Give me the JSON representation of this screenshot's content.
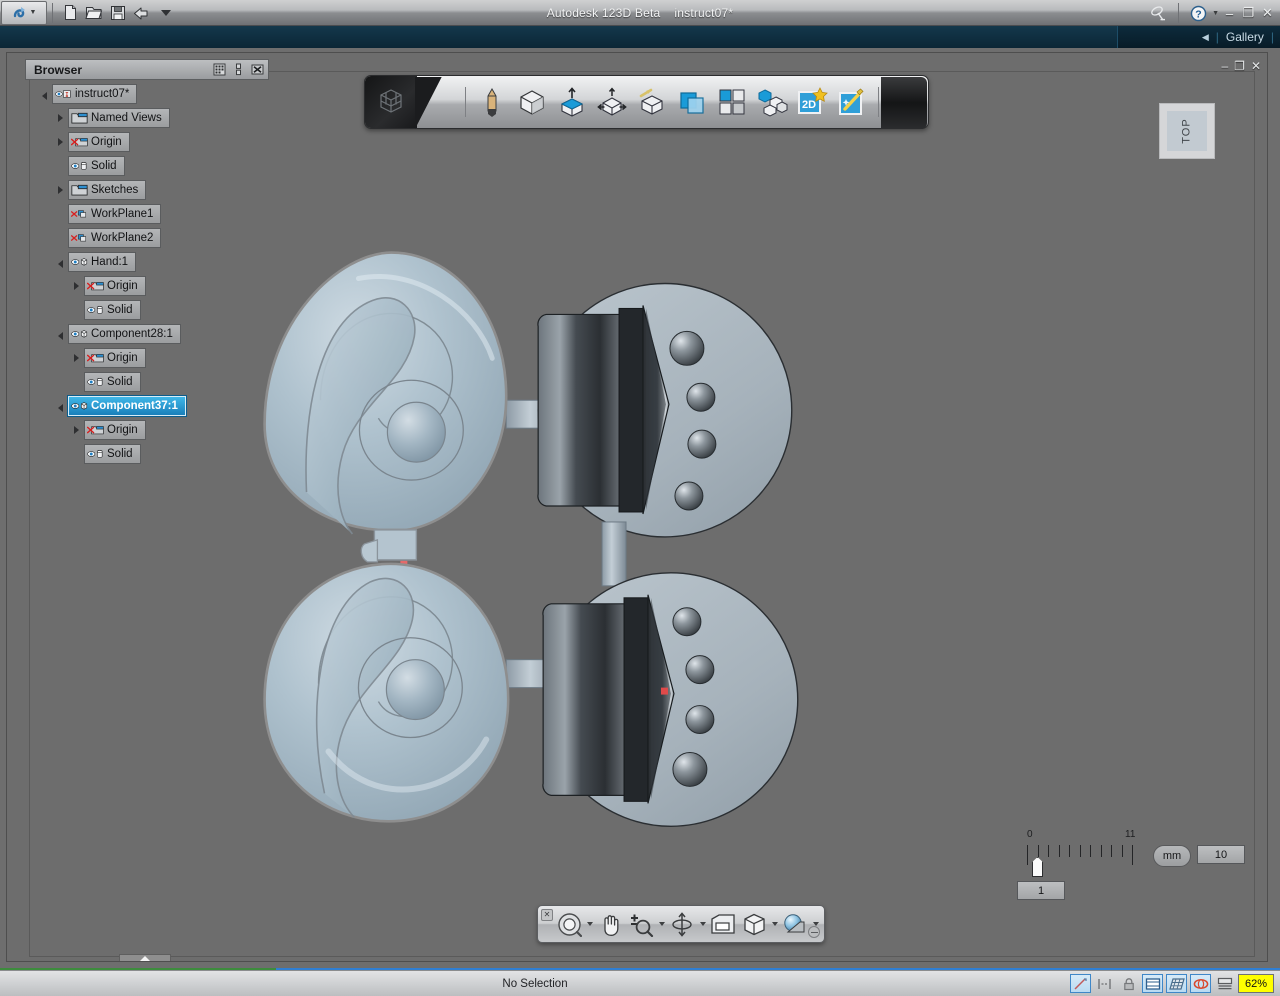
{
  "titlebar": {
    "app_title": "Autodesk 123D Beta",
    "document_title": "instruct07*",
    "icons": [
      {
        "name": "app-logo-icon",
        "label": "123D"
      },
      {
        "name": "new-file-icon",
        "label": "New"
      },
      {
        "name": "open-file-icon",
        "label": "Open"
      },
      {
        "name": "save-icon",
        "label": "Save"
      },
      {
        "name": "undo-icon",
        "label": "Undo"
      },
      {
        "name": "quick-access-dropdown-icon",
        "label": "Customize"
      }
    ],
    "right_icons": [
      {
        "name": "broadcast-icon",
        "label": "Communication Center"
      },
      {
        "name": "help-icon",
        "label": "Help"
      }
    ],
    "window_buttons": {
      "minimize": "–",
      "restore": "❐",
      "close": "✕"
    }
  },
  "docbar": {
    "collapse_arrow": "◀",
    "divider": "|",
    "gallery_label": "Gallery",
    "trailing_divider": "|"
  },
  "document_window_buttons": {
    "minimize": "–",
    "restore": "❐",
    "close": "✕"
  },
  "browser": {
    "title": "Browser",
    "header_buttons": [
      {
        "name": "browser-display-toggle-button",
        "label": "Display"
      },
      {
        "name": "browser-dock-button",
        "label": "Dock"
      },
      {
        "name": "browser-close-button",
        "label": "Close"
      }
    ],
    "tree": [
      {
        "label": "instruct07*",
        "indent": 0,
        "twist": "open",
        "icon": "eye-pin-icon",
        "selected": false
      },
      {
        "label": "Named Views",
        "indent": 1,
        "twist": "closed",
        "icon": "folder-icon",
        "selected": false
      },
      {
        "label": "Origin",
        "indent": 1,
        "twist": "closed",
        "icon": "hidden-folder-icon",
        "selected": false
      },
      {
        "label": "Solid",
        "indent": 1,
        "twist": "none",
        "icon": "eye-solid-icon",
        "selected": false
      },
      {
        "label": "Sketches",
        "indent": 1,
        "twist": "closed",
        "icon": "folder-icon",
        "selected": false
      },
      {
        "label": "WorkPlane1",
        "indent": 1,
        "twist": "none",
        "icon": "hidden-plane-icon",
        "selected": false
      },
      {
        "label": "WorkPlane2",
        "indent": 1,
        "twist": "none",
        "icon": "hidden-plane-icon",
        "selected": false
      },
      {
        "label": "Hand:1",
        "indent": 1,
        "twist": "open",
        "icon": "eye-cube-icon",
        "selected": false
      },
      {
        "label": "Origin",
        "indent": 2,
        "twist": "closed",
        "icon": "hidden-folder-icon",
        "selected": false
      },
      {
        "label": "Solid",
        "indent": 2,
        "twist": "none",
        "icon": "eye-solid-icon",
        "selected": false
      },
      {
        "label": "Component28:1",
        "indent": 1,
        "twist": "open",
        "icon": "eye-cube-icon",
        "selected": false
      },
      {
        "label": "Origin",
        "indent": 2,
        "twist": "closed",
        "icon": "hidden-folder-icon",
        "selected": false
      },
      {
        "label": "Solid",
        "indent": 2,
        "twist": "none",
        "icon": "eye-solid-icon",
        "selected": false
      },
      {
        "label": "Component37:1",
        "indent": 1,
        "twist": "open",
        "icon": "eye-cube-icon",
        "selected": true
      },
      {
        "label": "Origin",
        "indent": 2,
        "twist": "closed",
        "icon": "hidden-folder-icon",
        "selected": false
      },
      {
        "label": "Solid",
        "indent": 2,
        "twist": "none",
        "icon": "eye-solid-icon",
        "selected": false
      }
    ]
  },
  "main_toolbar": {
    "buttons": [
      {
        "name": "sketch-pencil-icon",
        "label": "Sketch"
      },
      {
        "name": "primitives-cube-icon",
        "label": "Primitives"
      },
      {
        "name": "construct-extrude-icon",
        "label": "Construct"
      },
      {
        "name": "modify-move-icon",
        "label": "Modify"
      },
      {
        "name": "pattern-arrow-cube-icon",
        "label": "Pattern"
      },
      {
        "name": "combine-layers-icon",
        "label": "Combine"
      },
      {
        "name": "grid-snap-icon",
        "label": "Grid"
      },
      {
        "name": "assemble-blocks-icon",
        "label": "Assemble"
      },
      {
        "name": "drawing-2d-icon",
        "label": "2D Drawing"
      },
      {
        "name": "smart-wand-icon",
        "label": "Smart Tools"
      }
    ]
  },
  "viewcube": {
    "face_label": "TOP"
  },
  "navbar": {
    "close_label": "✕",
    "buttons": [
      {
        "name": "steering-wheel-icon",
        "label": "SteeringWheels",
        "caret": true
      },
      {
        "name": "pan-hand-icon",
        "label": "Pan",
        "caret": false
      },
      {
        "name": "zoom-magnifier-icon",
        "label": "Zoom",
        "caret": true
      },
      {
        "name": "orbit-icon",
        "label": "Orbit",
        "caret": true
      },
      {
        "name": "fit-view-icon",
        "label": "Fit View",
        "caret": false
      },
      {
        "name": "view-cube-box-icon",
        "label": "Views",
        "caret": true
      },
      {
        "name": "shading-sphere-icon",
        "label": "Display Style",
        "caret": true
      }
    ]
  },
  "ruler": {
    "min_label": "0",
    "max_label": "11",
    "slider_value": "1",
    "unit": "mm",
    "step_value": "10"
  },
  "statusbar": {
    "message": "No Selection",
    "buttons": [
      {
        "name": "snap-line-icon",
        "label": "Snap",
        "active": true
      },
      {
        "name": "dimension-icon",
        "label": "Dimension",
        "active": false
      },
      {
        "name": "lock-icon",
        "label": "Lock",
        "active": false
      },
      {
        "name": "grid-snap-icon",
        "label": "Grid Snap",
        "active": true
      },
      {
        "name": "grid-display-icon",
        "label": "Grid Display",
        "active": true
      },
      {
        "name": "orbit-status-icon",
        "label": "Orbit",
        "active": true
      },
      {
        "name": "split-view-icon",
        "label": "Split View",
        "active": false
      }
    ],
    "zoom_level": "62%"
  },
  "colors": {
    "viewport_bg": "#6d6d6d",
    "chrome_light": "#cfd1d3",
    "selection_blue": "#1a7fba",
    "accent_blue": "#2f7fd4",
    "accent_green": "#3d8c3d",
    "model_shell": "#a9bcc8",
    "model_metal": "#3c4247",
    "zoom_highlight": "#ffff00",
    "marker_red": "#e04a4a"
  }
}
